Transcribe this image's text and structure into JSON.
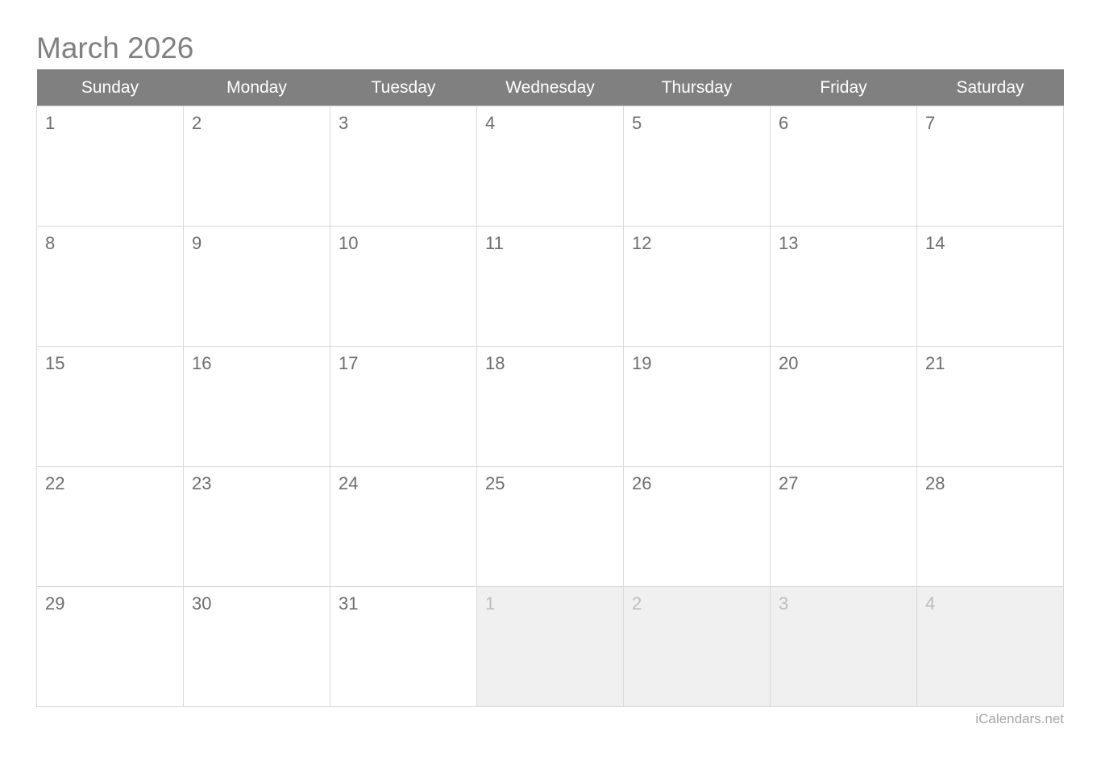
{
  "calendar": {
    "title": "March 2026",
    "month": "March",
    "year": "2026",
    "weekday_headers": [
      "Sunday",
      "Monday",
      "Tuesday",
      "Wednesday",
      "Thursday",
      "Friday",
      "Saturday"
    ],
    "weeks": [
      [
        {
          "day": "1",
          "other_month": false
        },
        {
          "day": "2",
          "other_month": false
        },
        {
          "day": "3",
          "other_month": false
        },
        {
          "day": "4",
          "other_month": false
        },
        {
          "day": "5",
          "other_month": false
        },
        {
          "day": "6",
          "other_month": false
        },
        {
          "day": "7",
          "other_month": false
        }
      ],
      [
        {
          "day": "8",
          "other_month": false
        },
        {
          "day": "9",
          "other_month": false
        },
        {
          "day": "10",
          "other_month": false
        },
        {
          "day": "11",
          "other_month": false
        },
        {
          "day": "12",
          "other_month": false
        },
        {
          "day": "13",
          "other_month": false
        },
        {
          "day": "14",
          "other_month": false
        }
      ],
      [
        {
          "day": "15",
          "other_month": false
        },
        {
          "day": "16",
          "other_month": false
        },
        {
          "day": "17",
          "other_month": false
        },
        {
          "day": "18",
          "other_month": false
        },
        {
          "day": "19",
          "other_month": false
        },
        {
          "day": "20",
          "other_month": false
        },
        {
          "day": "21",
          "other_month": false
        }
      ],
      [
        {
          "day": "22",
          "other_month": false
        },
        {
          "day": "23",
          "other_month": false
        },
        {
          "day": "24",
          "other_month": false
        },
        {
          "day": "25",
          "other_month": false
        },
        {
          "day": "26",
          "other_month": false
        },
        {
          "day": "27",
          "other_month": false
        },
        {
          "day": "28",
          "other_month": false
        }
      ],
      [
        {
          "day": "29",
          "other_month": false
        },
        {
          "day": "30",
          "other_month": false
        },
        {
          "day": "31",
          "other_month": false
        },
        {
          "day": "1",
          "other_month": true
        },
        {
          "day": "2",
          "other_month": true
        },
        {
          "day": "3",
          "other_month": true
        },
        {
          "day": "4",
          "other_month": true
        }
      ]
    ]
  },
  "footer": {
    "watermark": "iCalendars.net"
  },
  "colors": {
    "header_background": "#808080",
    "header_text": "#ffffff",
    "title_text": "#808080",
    "day_number": "#6e6e6e",
    "other_month_day_number": "#bdbdbd",
    "other_month_background": "#f0f0f0",
    "grid_border": "#d9d9d9",
    "page_background": "#ffffff",
    "watermark_text": "#a6a6a6"
  }
}
